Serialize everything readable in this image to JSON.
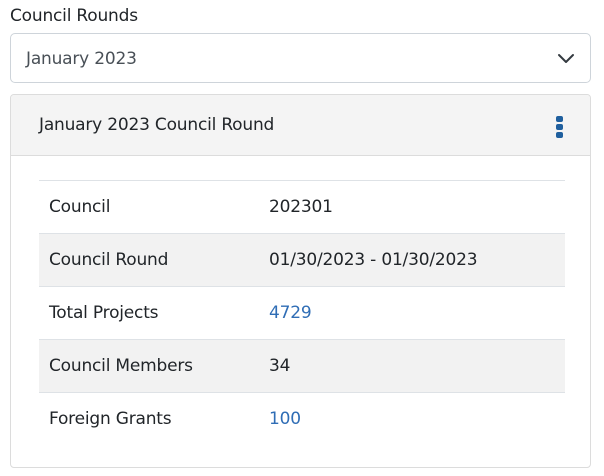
{
  "field": {
    "label": "Council Rounds",
    "selected": "January 2023"
  },
  "card": {
    "title": "January 2023 Council Round",
    "rows": [
      {
        "label": "Council",
        "value": "202301",
        "link": false
      },
      {
        "label": "Council Round",
        "value": "01/30/2023 - 01/30/2023",
        "link": false
      },
      {
        "label": "Total Projects",
        "value": "4729",
        "link": true
      },
      {
        "label": "Council Members",
        "value": "34",
        "link": false
      },
      {
        "label": "Foreign Grants",
        "value": "100",
        "link": true
      }
    ]
  },
  "icons": {
    "dropdown": "chevron-down-icon",
    "menu": "kebab-menu-icon"
  },
  "colors": {
    "link": "#2f6db5",
    "menu_icon": "#1f5f9e",
    "header_bg": "#f4f4f4",
    "stripe_bg": "#f2f2f2"
  }
}
